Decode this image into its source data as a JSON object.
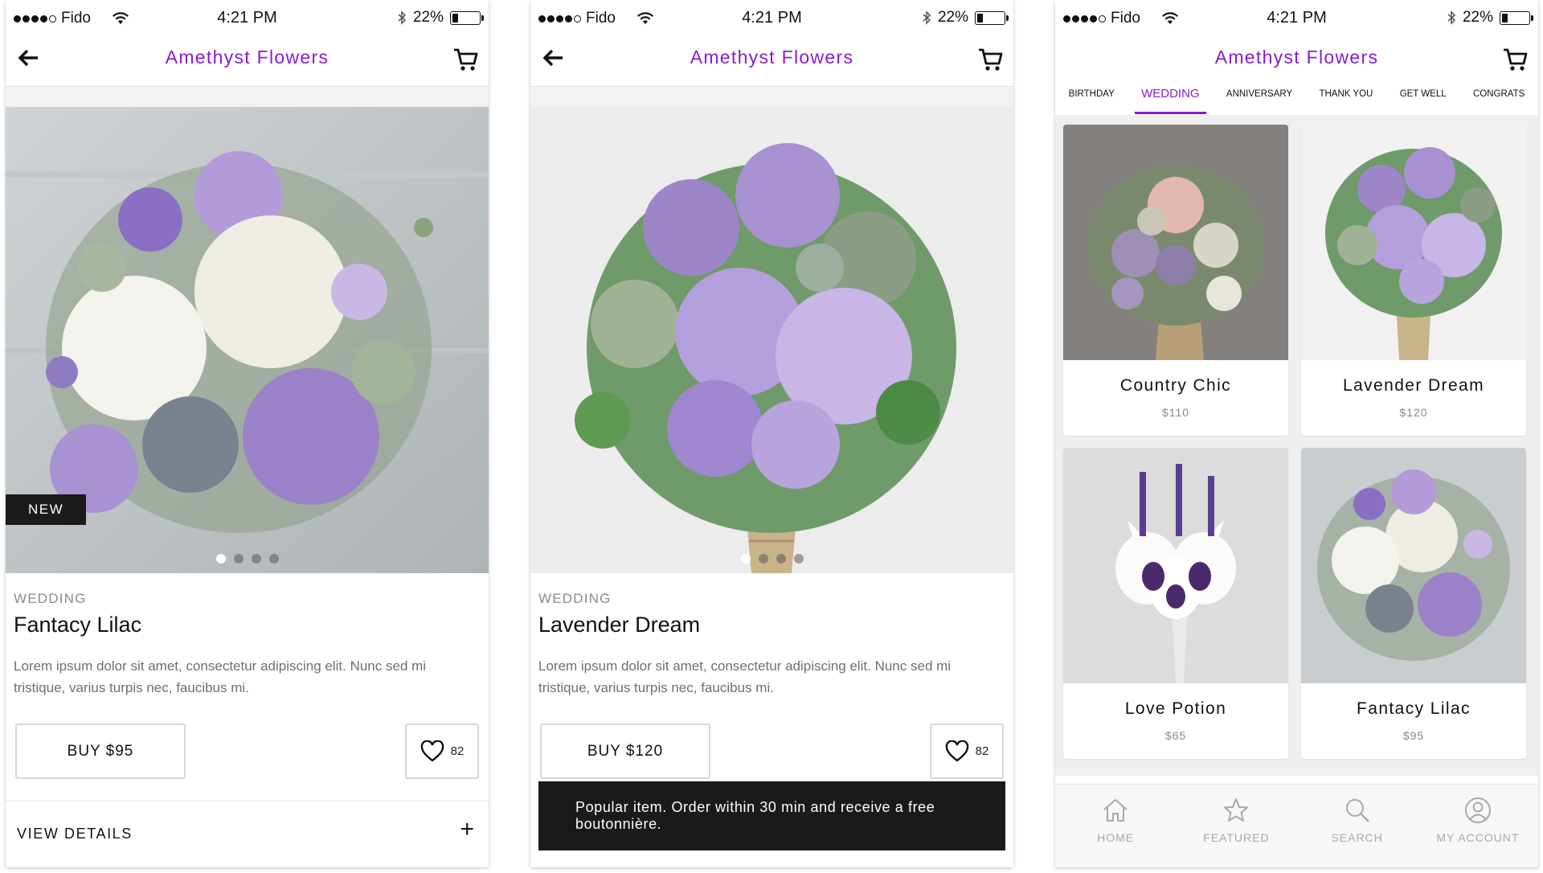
{
  "status_bar": {
    "carrier": "Fido",
    "time": "4:21 PM",
    "battery": "22%",
    "battery_level": 0.22
  },
  "app": {
    "title": "Amethyst Flowers"
  },
  "screens": {
    "detail_1": {
      "badge": "NEW",
      "category": "WEDDING",
      "name": "Fantacy Lilac",
      "description": "Lorem ipsum dolor sit amet, consectetur adipiscing elit. Nunc sed mi tristique, varius turpis nec, faucibus mi.",
      "buy_label": "BUY $95",
      "likes": "82",
      "details_label": "VIEW DETAILS",
      "details_icon": "+"
    },
    "detail_2": {
      "category": "WEDDING",
      "name": "Lavender Dream",
      "description": "Lorem ipsum dolor sit amet, consectetur adipiscing elit. Nunc sed mi tristique, varius turpis nec, faucibus mi.",
      "buy_label": "BUY $120",
      "likes": "82",
      "toast": "Popular item. Order within 30 min and receive a free boutonnière."
    },
    "catalog": {
      "tabs": [
        "BIRTHDAY",
        "WEDDING",
        "ANNIVERSARY",
        "THANK YOU",
        "GET WELL",
        "CONGRATS"
      ],
      "active_tab": "WEDDING",
      "products": [
        {
          "name": "Country Chic",
          "price": "$110"
        },
        {
          "name": "Lavender Dream",
          "price": "$120"
        },
        {
          "name": "Love Potion",
          "price": "$65"
        },
        {
          "name": "Fantacy Lilac",
          "price": "$95"
        }
      ],
      "tabbar": [
        {
          "label": "HOME",
          "icon": "home-icon"
        },
        {
          "label": "FEATURED",
          "icon": "star-icon"
        },
        {
          "label": "SEARCH",
          "icon": "search-icon"
        },
        {
          "label": "MY ACCOUNT",
          "icon": "account-icon"
        }
      ]
    }
  },
  "colors": {
    "accent": "#8a1bd0",
    "dark": "#1a1a1a",
    "muted": "#888888"
  }
}
